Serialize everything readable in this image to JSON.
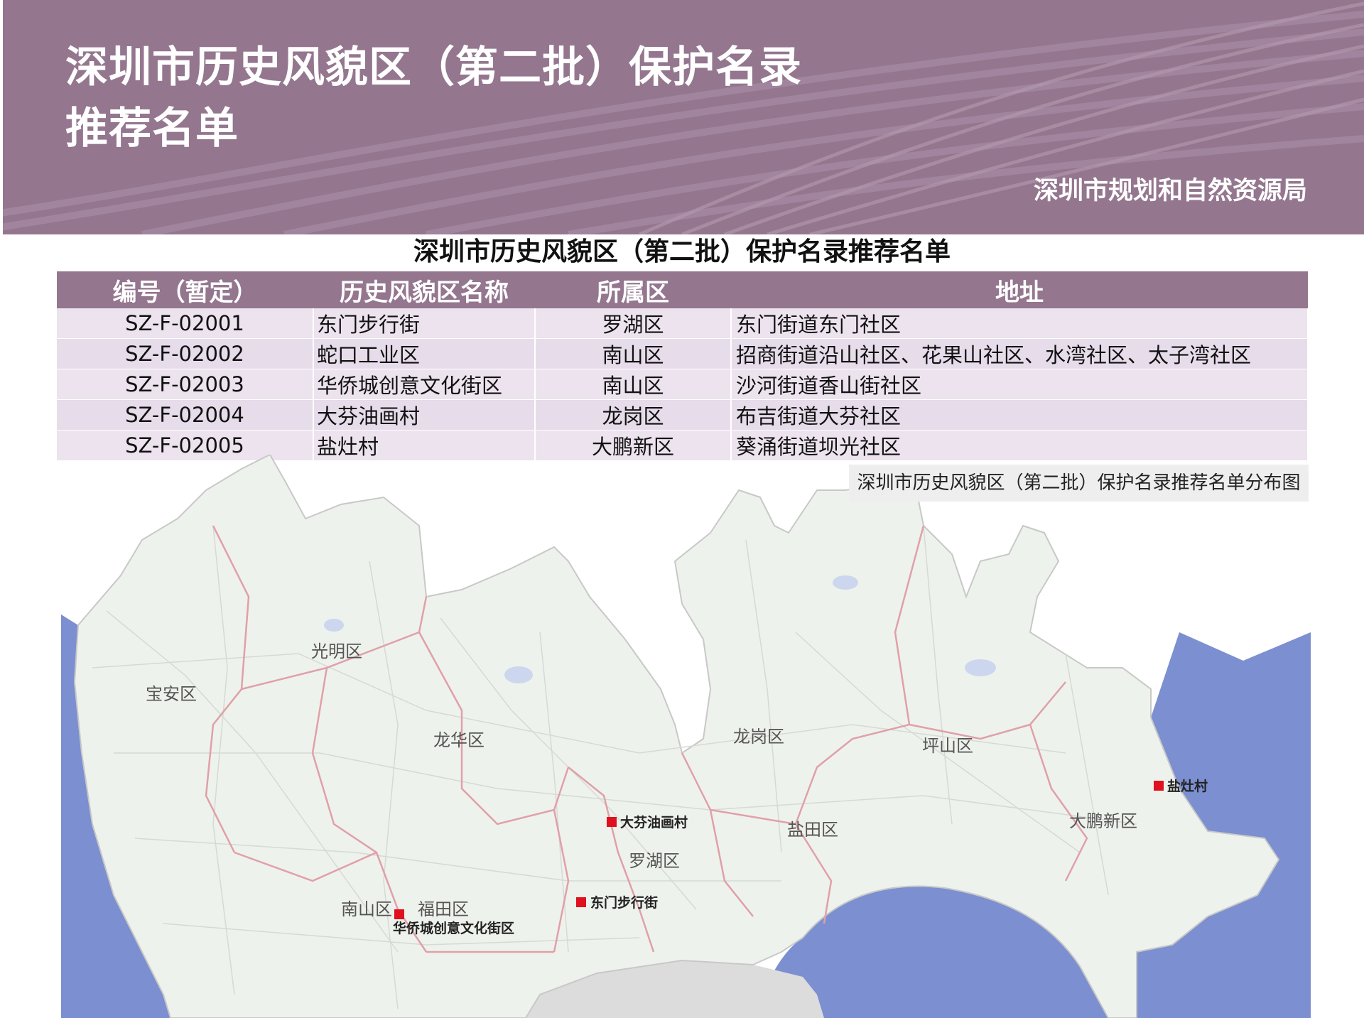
{
  "banner": {
    "title_line1": "深圳市历史风貌区（第二批）保护名录",
    "title_line2": "推荐名单",
    "org": "深圳市规划和自然资源局",
    "color": "#94768f"
  },
  "table": {
    "title": "深圳市历史风貌区（第二批）保护名录推荐名单",
    "headers": [
      "编号（暂定）",
      "历史风貌区名称",
      "所属区",
      "地址"
    ],
    "rows": [
      {
        "id": "SZ-F-02001",
        "name": "东门步行街",
        "district": "罗湖区",
        "address": "东门街道东门社区"
      },
      {
        "id": "SZ-F-02002",
        "name": "蛇口工业区",
        "district": "南山区",
        "address": "招商街道沿山社区、花果山社区、水湾社区、太子湾社区"
      },
      {
        "id": "SZ-F-02003",
        "name": "华侨城创意文化街区",
        "district": "南山区",
        "address": "沙河街道香山街社区"
      },
      {
        "id": "SZ-F-02004",
        "name": "大芬油画村",
        "district": "龙岗区",
        "address": "布吉街道大芬社区"
      },
      {
        "id": "SZ-F-02005",
        "name": "盐灶村",
        "district": "大鹏新区",
        "address": "葵涌街道坝光社区"
      }
    ]
  },
  "map": {
    "caption": "深圳市历史风貌区（第二批）保护名录推荐名单分布图",
    "districts": [
      "光明区",
      "宝安区",
      "龙华区",
      "龙岗区",
      "坪山区",
      "盐田区",
      "大鹏新区",
      "罗湖区",
      "南山区",
      "福田区"
    ],
    "sites": [
      "大芬油画村",
      "东门步行街",
      "华侨城创意文化街区",
      "盐灶村"
    ],
    "colors": {
      "sea": "#7b8fd1",
      "land": "#eef2ec",
      "boundary": "#e0a0a8",
      "marker": "#e0101e",
      "hk": "#dcdcdc"
    }
  }
}
